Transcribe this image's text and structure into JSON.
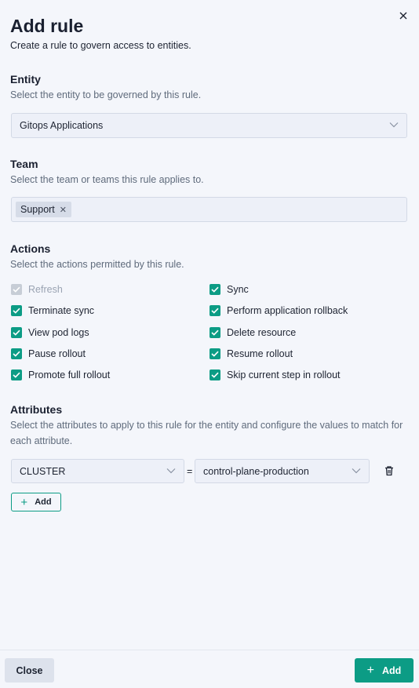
{
  "header": {
    "title": "Add rule",
    "subtitle": "Create a rule to govern access to entities."
  },
  "entity": {
    "title": "Entity",
    "description": "Select the entity to be governed by this rule.",
    "selected": "Gitops Applications"
  },
  "team": {
    "title": "Team",
    "description": "Select the team or teams this rule applies to.",
    "tags": [
      "Support"
    ]
  },
  "actions": {
    "title": "Actions",
    "description": "Select the actions permitted by this rule.",
    "left": [
      {
        "label": "Refresh",
        "checked": true,
        "disabled": true
      },
      {
        "label": "Terminate sync",
        "checked": true,
        "disabled": false
      },
      {
        "label": "View pod logs",
        "checked": true,
        "disabled": false
      },
      {
        "label": "Pause rollout",
        "checked": true,
        "disabled": false
      },
      {
        "label": "Promote full rollout",
        "checked": true,
        "disabled": false
      }
    ],
    "right": [
      {
        "label": "Sync",
        "checked": true,
        "disabled": false
      },
      {
        "label": "Perform application rollback",
        "checked": true,
        "disabled": false
      },
      {
        "label": "Delete resource",
        "checked": true,
        "disabled": false
      },
      {
        "label": "Resume rollout",
        "checked": true,
        "disabled": false
      },
      {
        "label": "Skip current step in rollout",
        "checked": true,
        "disabled": false
      }
    ]
  },
  "attributes": {
    "title": "Attributes",
    "description": "Select the attributes to apply to this rule for the entity and configure the values to match for each attribute.",
    "key": "CLUSTER",
    "operator": "=",
    "value": "control-plane-production",
    "add_label": "Add"
  },
  "footer": {
    "close_label": "Close",
    "add_label": "Add"
  },
  "colors": {
    "accent": "#0c9c85",
    "background": "#f4f6fb"
  }
}
